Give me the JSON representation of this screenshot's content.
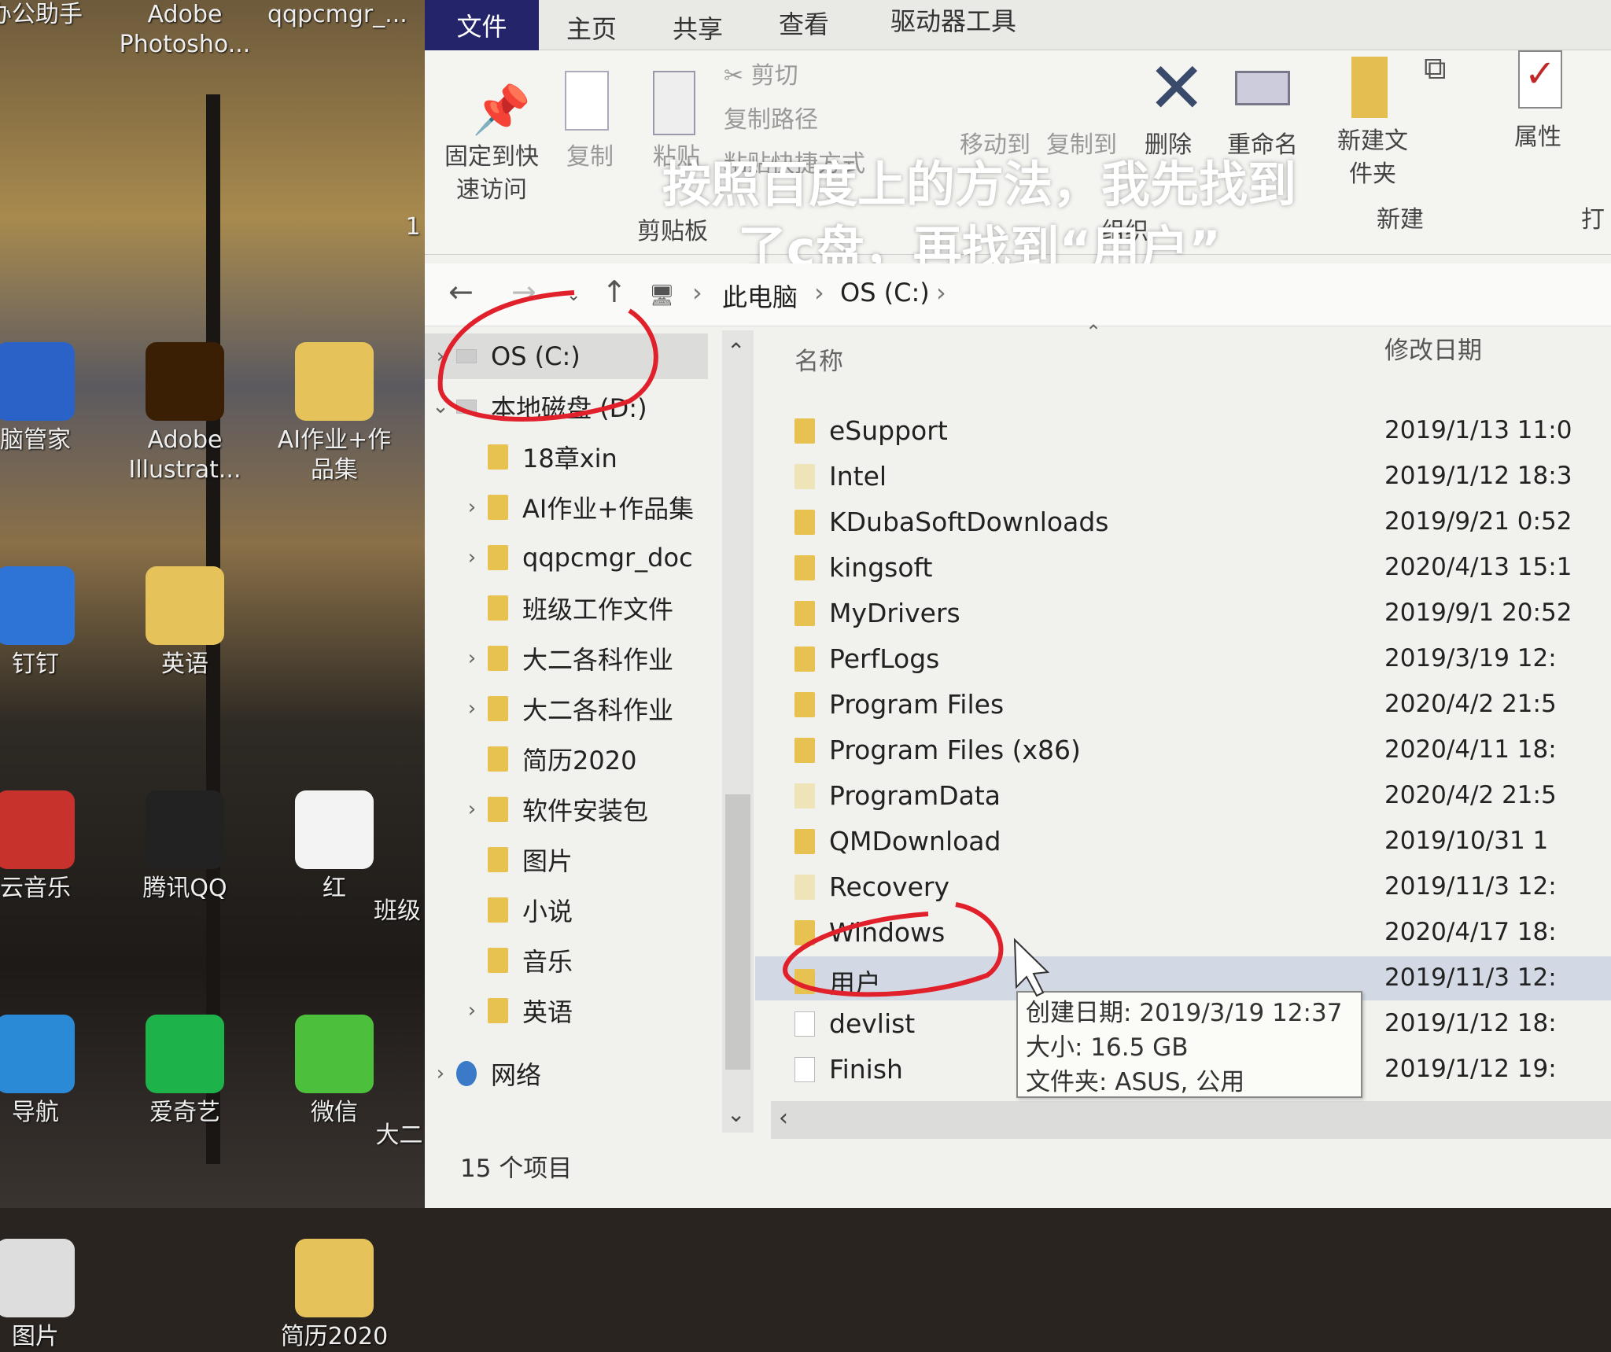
{
  "desktop": {
    "icons": [
      {
        "label": "办公助手",
        "x": 0,
        "y": 0
      },
      {
        "label": "Adobe Photosho...",
        "x": 1,
        "y": 0
      },
      {
        "label": "qqpcmgr_...",
        "x": 2,
        "y": 0
      },
      {
        "label": "脑管家",
        "x": 0,
        "y": 1,
        "color": "#2b62c8"
      },
      {
        "label": "Adobe Illustrat...",
        "x": 1,
        "y": 1,
        "color": "#3a1f04"
      },
      {
        "label": "AI作业+作品集",
        "x": 2,
        "y": 1,
        "color": "#e6c35a"
      },
      {
        "label": "钉钉",
        "x": 0,
        "y": 2,
        "color": "#2d74d6"
      },
      {
        "label": "英语",
        "x": 1,
        "y": 2,
        "color": "#e6c35a"
      },
      {
        "label": "云音乐",
        "x": 0,
        "y": 3,
        "color": "#c8322c"
      },
      {
        "label": "腾讯QQ",
        "x": 1,
        "y": 3,
        "color": "#222"
      },
      {
        "label": "红",
        "x": 2,
        "y": 3,
        "color": "#f3f3f3"
      },
      {
        "label": "导航",
        "x": 0,
        "y": 4,
        "color": "#2b8ad6"
      },
      {
        "label": "爱奇艺",
        "x": 1,
        "y": 4,
        "color": "#1db34a"
      },
      {
        "label": "微信",
        "x": 2,
        "y": 4,
        "color": "#4cbf3c"
      },
      {
        "label": "图片",
        "x": 0,
        "y": 5,
        "color": "#ddd"
      },
      {
        "label": "简历2020",
        "x": 2,
        "y": 5,
        "color": "#e6c35a"
      }
    ],
    "partial": [
      "班级",
      "大二",
      "1"
    ]
  },
  "ribbon": {
    "tabs": [
      "文件",
      "主页",
      "共享",
      "查看",
      "驱动器工具"
    ],
    "pin": "固定到快速访问",
    "copy": "复制",
    "paste": "粘贴",
    "cut": "剪切",
    "copy_path": "复制路径",
    "paste_shortcut": "粘贴快捷方式",
    "clipboard_group": "剪贴板",
    "move_to": "移动到",
    "copy_to": "复制到",
    "delete": "删除",
    "rename": "重命名",
    "organize_group": "组织",
    "new_folder": "新建文件夹",
    "new_group": "新建",
    "properties": "属性",
    "open_group": "打"
  },
  "caption": "按照百度上的方法，我先找到了c盘，再找到“用户”",
  "address": {
    "crumbs": [
      "此电脑",
      "OS (C:)"
    ]
  },
  "navpane": [
    {
      "label": "OS (C:)",
      "type": "drive",
      "expander": "›"
    },
    {
      "label": "本地磁盘 (D:)",
      "type": "drive",
      "expander": "⌄"
    },
    {
      "label": "18章xin",
      "type": "folder",
      "expander": ""
    },
    {
      "label": "AI作业+作品集",
      "type": "folder",
      "expander": "›"
    },
    {
      "label": "qqpcmgr_doc",
      "type": "folder",
      "expander": "›"
    },
    {
      "label": "班级工作文件",
      "type": "folder",
      "expander": ""
    },
    {
      "label": "大二各科作业",
      "type": "folder",
      "expander": "›"
    },
    {
      "label": "大二各科作业",
      "type": "folder",
      "expander": "›"
    },
    {
      "label": "简历2020",
      "type": "folder",
      "expander": ""
    },
    {
      "label": "软件安装包",
      "type": "folder",
      "expander": "›"
    },
    {
      "label": "图片",
      "type": "folder",
      "expander": ""
    },
    {
      "label": "小说",
      "type": "folder",
      "expander": ""
    },
    {
      "label": "音乐",
      "type": "folder",
      "expander": ""
    },
    {
      "label": "英语",
      "type": "folder",
      "expander": "›"
    },
    {
      "label": "网络",
      "type": "network",
      "expander": "›"
    }
  ],
  "list": {
    "col_name": "名称",
    "col_date": "修改日期",
    "rows": [
      {
        "name": "eSupport",
        "date": "2019/1/13 11:0",
        "type": "folder"
      },
      {
        "name": "Intel",
        "date": "2019/1/12 18:3",
        "type": "pale"
      },
      {
        "name": "KDubaSoftDownloads",
        "date": "2019/9/21 0:52",
        "type": "folder"
      },
      {
        "name": "kingsoft",
        "date": "2020/4/13 15:1",
        "type": "folder"
      },
      {
        "name": "MyDrivers",
        "date": "2019/9/1 20:52",
        "type": "folder"
      },
      {
        "name": "PerfLogs",
        "date": "2019/3/19 12:",
        "type": "folder"
      },
      {
        "name": "Program Files",
        "date": "2020/4/2 21:5",
        "type": "folder"
      },
      {
        "name": "Program Files (x86)",
        "date": "2020/4/11 18:",
        "type": "folder"
      },
      {
        "name": "ProgramData",
        "date": "2020/4/2 21:5",
        "type": "pale"
      },
      {
        "name": "QMDownload",
        "date": "2019/10/31 1",
        "type": "folder"
      },
      {
        "name": "Recovery",
        "date": "2019/11/3 12:",
        "type": "pale"
      },
      {
        "name": "Windows",
        "date": "2020/4/17 18:",
        "type": "folder"
      },
      {
        "name": "用户",
        "date": "2019/11/3 12:",
        "type": "folder",
        "selected": true
      },
      {
        "name": "devlist",
        "date": "2019/1/12 18:",
        "type": "file"
      },
      {
        "name": "Finish",
        "date": "2019/1/12 19:",
        "type": "file"
      }
    ]
  },
  "tooltip": {
    "created": "创建日期: 2019/3/19 12:37",
    "size": "大小: 16.5 GB",
    "folders": "文件夹: ASUS, 公用"
  },
  "status": {
    "count": "15 个项目"
  },
  "colors": {
    "file_tab": "#24246a",
    "annotation": "#e0202a",
    "folder": "#e8c250",
    "selected_row": "#d3d9e4"
  }
}
